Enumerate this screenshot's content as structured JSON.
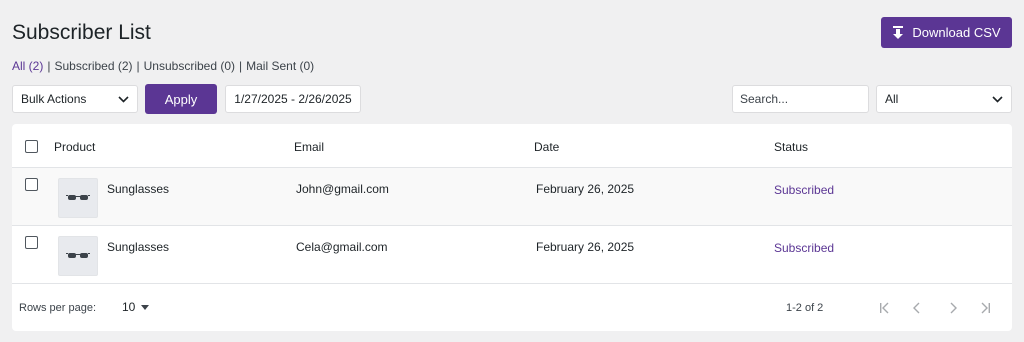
{
  "header": {
    "title": "Subscriber List",
    "download_label": "Download CSV"
  },
  "filters": [
    {
      "label": "All (2)",
      "current": true
    },
    {
      "label": "Subscribed (2)",
      "current": false
    },
    {
      "label": "Unsubscribed (0)",
      "current": false
    },
    {
      "label": "Mail Sent (0)",
      "current": false
    }
  ],
  "toolbar": {
    "bulk_actions": "Bulk Actions",
    "apply_label": "Apply",
    "date_range": "1/27/2025 - 2/26/2025",
    "search_placeholder": "Search...",
    "status_filter": "All"
  },
  "table": {
    "columns": {
      "product": "Product",
      "email": "Email",
      "date": "Date",
      "status": "Status"
    },
    "rows": [
      {
        "product": "Sunglasses",
        "email": "John@gmail.com",
        "date": "February 26, 2025",
        "status": "Subscribed"
      },
      {
        "product": "Sunglasses",
        "email": "Cela@gmail.com",
        "date": "February 26, 2025",
        "status": "Subscribed"
      }
    ]
  },
  "footer": {
    "rows_per_page_label": "Rows per page:",
    "rows_per_page_value": "10",
    "range_text": "1-2 of 2"
  },
  "colors": {
    "accent": "#5b3694",
    "background": "#f0f0f1"
  }
}
